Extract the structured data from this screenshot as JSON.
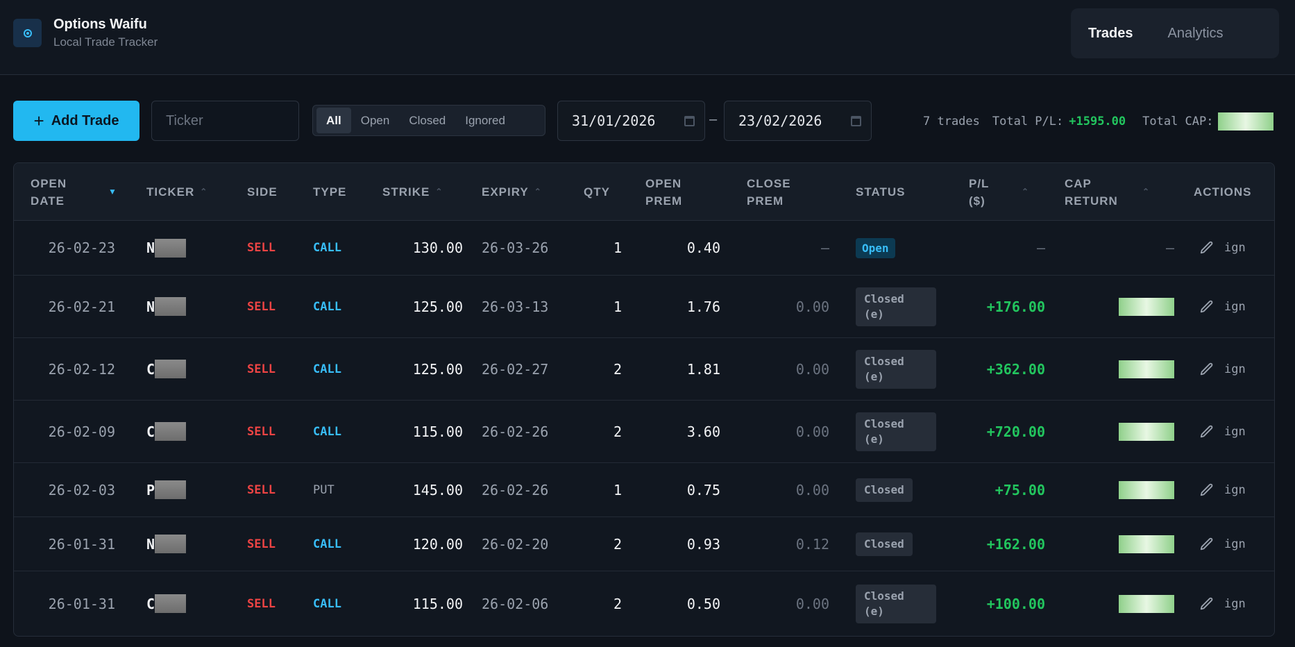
{
  "app": {
    "title": "Options Waifu",
    "subtitle": "Local Trade Tracker"
  },
  "nav": {
    "tabs": [
      {
        "label": "Trades",
        "active": true
      },
      {
        "label": "Analytics",
        "active": false
      }
    ]
  },
  "toolbar": {
    "add_label": "Add Trade",
    "ticker_placeholder": "Ticker",
    "filters": [
      {
        "label": "All",
        "active": true
      },
      {
        "label": "Open"
      },
      {
        "label": "Closed"
      },
      {
        "label": "Ignored"
      }
    ],
    "date_from": "31/01/2026",
    "date_to": "23/02/2026",
    "date_separator": "–"
  },
  "summary": {
    "trades": "7 trades",
    "pl_label": "Total P/L:",
    "pl_value": "+1595.00",
    "cap_label": "Total CAP:"
  },
  "table": {
    "headers": {
      "open_date": "OPEN DATE",
      "ticker": "TICKER",
      "side": "SIDE",
      "type": "TYPE",
      "strike": "STRIKE",
      "expiry": "EXPIRY",
      "qty": "QTY",
      "open_prem": "OPEN PREM",
      "close_prem": "CLOSE PREM",
      "status": "STATUS",
      "pl": "P/L ($)",
      "cap_return": "CAP RETURN",
      "actions": "ACTIONS"
    },
    "rows": [
      {
        "open_date": "26-02-23",
        "ticker": "N",
        "side": "SELL",
        "type": "CALL",
        "strike": "130.00",
        "expiry": "26-03-26",
        "qty": "1",
        "open_prem": "0.40",
        "close_prem": "—",
        "status": "Open",
        "pl": "—",
        "cap_return": "—",
        "ign": "ign"
      },
      {
        "open_date": "26-02-21",
        "ticker": "N",
        "side": "SELL",
        "type": "CALL",
        "strike": "125.00",
        "expiry": "26-03-13",
        "qty": "1",
        "open_prem": "1.76",
        "close_prem": "0.00",
        "status": "Closed (e)",
        "pl": "+176.00",
        "cap_return": "",
        "ign": "ign"
      },
      {
        "open_date": "26-02-12",
        "ticker": "C",
        "side": "SELL",
        "type": "CALL",
        "strike": "125.00",
        "expiry": "26-02-27",
        "qty": "2",
        "open_prem": "1.81",
        "close_prem": "0.00",
        "status": "Closed (e)",
        "pl": "+362.00",
        "cap_return": "",
        "ign": "ign"
      },
      {
        "open_date": "26-02-09",
        "ticker": "C",
        "side": "SELL",
        "type": "CALL",
        "strike": "115.00",
        "expiry": "26-02-26",
        "qty": "2",
        "open_prem": "3.60",
        "close_prem": "0.00",
        "status": "Closed (e)",
        "pl": "+720.00",
        "cap_return": "",
        "ign": "ign"
      },
      {
        "open_date": "26-02-03",
        "ticker": "P",
        "side": "SELL",
        "type": "PUT",
        "strike": "145.00",
        "expiry": "26-02-26",
        "qty": "1",
        "open_prem": "0.75",
        "close_prem": "0.00",
        "status": "Closed",
        "pl": "+75.00",
        "cap_return": "",
        "ign": "ign"
      },
      {
        "open_date": "26-01-31",
        "ticker": "N",
        "side": "SELL",
        "type": "CALL",
        "strike": "120.00",
        "expiry": "26-02-20",
        "qty": "2",
        "open_prem": "0.93",
        "close_prem": "0.12",
        "status": "Closed",
        "pl": "+162.00",
        "cap_return": "",
        "ign": "ign"
      },
      {
        "open_date": "26-01-31",
        "ticker": "C",
        "side": "SELL",
        "type": "CALL",
        "strike": "115.00",
        "expiry": "26-02-06",
        "qty": "2",
        "open_prem": "0.50",
        "close_prem": "0.00",
        "status": "Closed (e)",
        "pl": "+100.00",
        "cap_return": "",
        "ign": "ign"
      }
    ]
  },
  "icons": {
    "add": "plus-icon",
    "edit": "pencil-icon",
    "calendar": "calendar-icon",
    "sort": "chevron-icon",
    "logo": "target-icon"
  },
  "colors": {
    "accent": "#22b8f0",
    "sell": "#ef4444",
    "call": "#38bdf8",
    "profit": "#22c55e"
  }
}
